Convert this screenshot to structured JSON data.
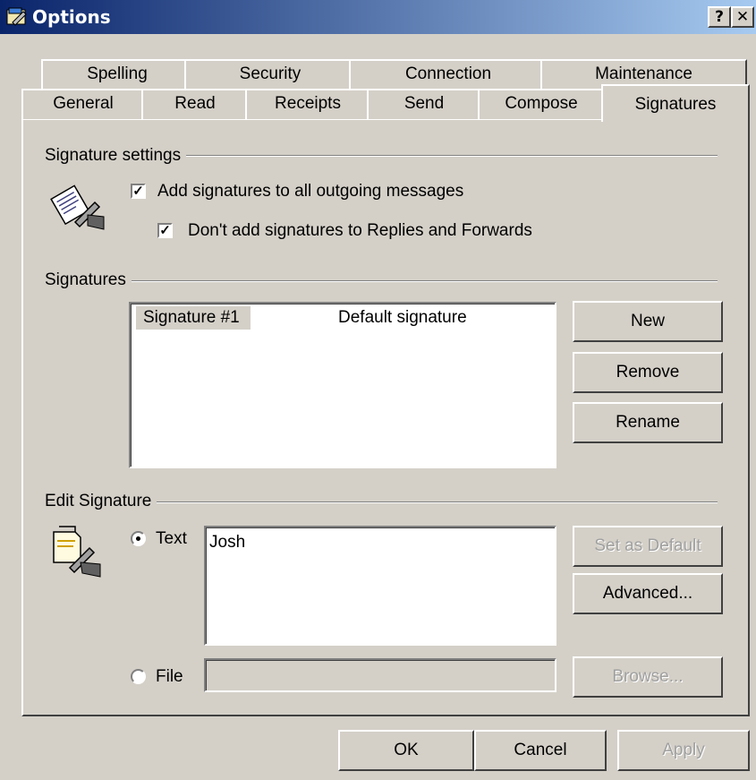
{
  "window": {
    "title": "Options",
    "help_label": "?",
    "close_label": "✕"
  },
  "tabs_row1": [
    "Spelling",
    "Security",
    "Connection",
    "Maintenance"
  ],
  "tabs_row2": [
    "General",
    "Read",
    "Receipts",
    "Send",
    "Compose",
    "Signatures"
  ],
  "signature_settings": {
    "group_label": "Signature settings",
    "add_all_label": "Add signatures to all outgoing messages",
    "add_all_checked": true,
    "no_replies_label": "Don't add signatures to Replies and Forwards",
    "no_replies_checked": true,
    "icon": "signature-pen-icon"
  },
  "signatures": {
    "group_label": "Signatures",
    "list": [
      {
        "name": "Signature #1",
        "status": "Default signature",
        "selected": true
      }
    ],
    "new_label": "New",
    "remove_label": "Remove",
    "rename_label": "Rename"
  },
  "edit_signature": {
    "group_label": "Edit Signature",
    "icon": "document-pen-icon",
    "text_option_label": "Text",
    "text_selected": true,
    "text_value": "Josh",
    "file_option_label": "File",
    "file_value": "",
    "set_default_label": "Set as Default",
    "advanced_label": "Advanced...",
    "browse_label": "Browse..."
  },
  "footer": {
    "ok_label": "OK",
    "cancel_label": "Cancel",
    "apply_label": "Apply"
  },
  "colors": {
    "titlebar_start": "#0a246a",
    "titlebar_end": "#a6caf0",
    "face": "#d4d0c8",
    "selection": "#d4d0c8"
  }
}
